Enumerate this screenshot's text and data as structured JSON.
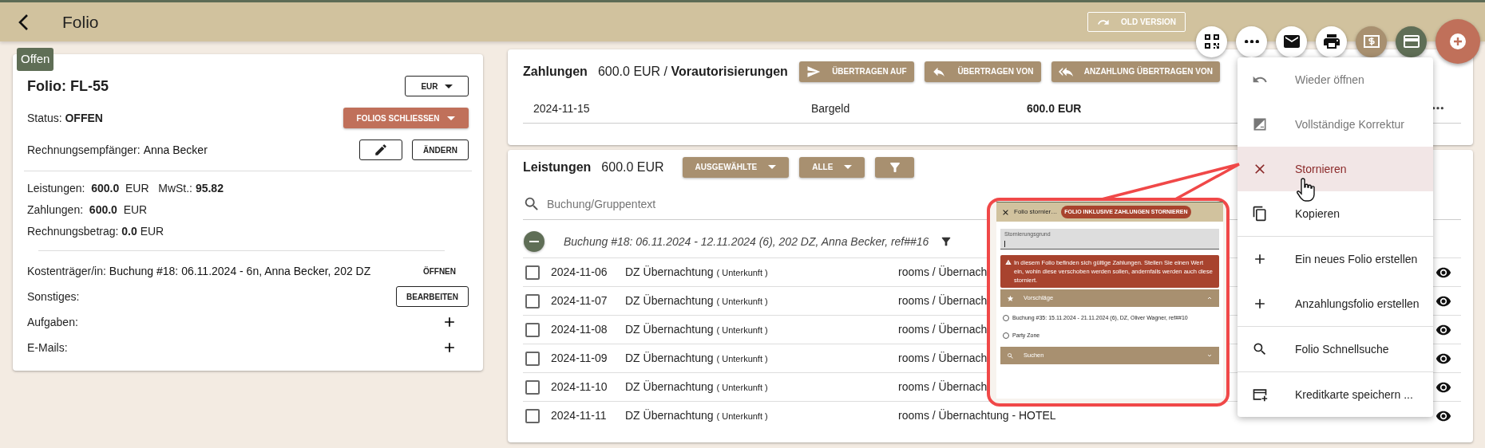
{
  "top_bar": {
    "title": "Folio",
    "old_version_button": "OLD VERSION"
  },
  "action_buttons": [
    {
      "kind": "qr"
    },
    {
      "kind": "more"
    },
    {
      "kind": "mail"
    },
    {
      "kind": "print"
    },
    {
      "kind": "bill"
    },
    {
      "kind": "card"
    },
    {
      "kind": "add"
    }
  ],
  "folio": {
    "badge": "Offen",
    "title": "Folio: FL-55",
    "currency": "EUR",
    "status": "Status: **OFFEN**",
    "close_button": "FOLIOS SCHLIESSEN",
    "recipient_label": "Rechnungsempfänger:",
    "recipient": "Anna Becker",
    "change_button": "ÄNDERN",
    "totals": [
      "Leistungen:  **600.0**  EUR   MwSt.: **95.82**",
      "Zahlungen:  **600.0**  EUR",
      "Rechnungsbetrag: **0.0** EUR"
    ],
    "payer_label": "Kostenträger/in:",
    "payer": "Buchung #18: 06.11.2024 - 6n, Anna Becker, 202 DZ",
    "open_button": "ÖFFNEN",
    "extras": [
      {
        "label": "Sonstiges:",
        "kind": "button",
        "button": "BEARBEITEN"
      },
      {
        "label": "Aufgaben:",
        "kind": "add"
      },
      {
        "label": "E-Mails:",
        "kind": "add"
      }
    ]
  },
  "payments": {
    "title": "Zahlungen",
    "summary": "600.0 EUR / **Vorautorisierungen**",
    "buttons": [
      {
        "label": "ÜBERTRAGEN AUF",
        "kind": "send"
      },
      {
        "label": "ÜBERTRAGEN VON",
        "kind": "reply"
      },
      {
        "label": "ANZAHLUNG ÜBERTRAGEN VON",
        "kind": "reply_all"
      }
    ],
    "rows": [
      {
        "date": "2024-11-15",
        "method": "Bargeld",
        "amount": "600.0 EUR"
      }
    ]
  },
  "services": {
    "title": "Leistungen",
    "total": "600.0 EUR",
    "buttons": [
      {
        "label": "AUSGEWÄHLTE",
        "kind": "dropdown"
      },
      {
        "label": "ALLE",
        "kind": "dropdown"
      },
      {
        "kind": "filter"
      }
    ],
    "search": {
      "placeholder": "Buchung/Gruppentext"
    },
    "group": {
      "label": "Buchung #18: 06.11.2024 - 12.11.2024 (6), 202 DZ, Anna Becker, ref##16",
      "expanded": true
    },
    "rows": [
      {
        "date": "2024-11-06",
        "name": "DZ Übernachtung",
        "category": "( Unterkunft )",
        "account": "rooms / Übernach",
        "checked": false
      },
      {
        "date": "2024-11-07",
        "name": "DZ Übernachtung",
        "category": "( Unterkunft )",
        "account": "rooms / Übernach",
        "checked": false
      },
      {
        "date": "2024-11-08",
        "name": "DZ Übernachtung",
        "category": "( Unterkunft )",
        "account": "rooms / Übernach",
        "checked": false
      },
      {
        "date": "2024-11-09",
        "name": "DZ Übernachtung",
        "category": "( Unterkunft )",
        "account": "rooms / Übernach",
        "checked": false
      },
      {
        "date": "2024-11-10",
        "name": "DZ Übernachtung",
        "category": "( Unterkunft )",
        "account": "rooms / Übernach",
        "checked": false
      },
      {
        "date": "2024-11-11",
        "name": "DZ Übernachtung",
        "category": "( Unterkunft )",
        "account": "rooms / Übernachtung - HOTEL",
        "checked": false
      }
    ]
  },
  "menu": {
    "sections": [
      [
        {
          "label": "Wieder öffnen",
          "kind": "undo",
          "disabled": true,
          "selected": false
        },
        {
          "label": "Vollständige Korrektur",
          "kind": "correction",
          "disabled": true,
          "selected": false
        },
        {
          "label": "Stornieren",
          "kind": "close",
          "disabled": false,
          "selected": true
        },
        {
          "label": "Kopieren",
          "kind": "copy",
          "disabled": false,
          "selected": false
        }
      ],
      [
        {
          "label": "Ein neues Folio erstellen",
          "kind": "add",
          "disabled": false,
          "selected": false
        },
        {
          "label": "Anzahlungsfolio erstellen",
          "kind": "add",
          "disabled": false,
          "selected": false
        }
      ],
      [
        {
          "label": "Folio Schnellsuche",
          "kind": "search",
          "disabled": false,
          "selected": false
        }
      ],
      [
        {
          "label": "Kreditkarte speichern ...",
          "kind": "card_add",
          "disabled": false,
          "selected": false
        }
      ]
    ]
  },
  "cancel_dialog_preview": {
    "title": "Folio stornier…",
    "confirm_button": "FOLIO INKLUSIVE ZAHLUNGEN STORNIEREN",
    "field": {
      "label": "Stornierungsgrund"
    },
    "alert": "In diesem Folio befinden sich gültige Zahlungen. Stellen Sie einen Wert ein, wohin diese verschoben werden sollen, andernfalls werden auch diese storniert.",
    "suggestions": {
      "title": "Vorschläge",
      "expanded": true,
      "options": [
        {
          "label": "Buchung #35: 15.11.2024 - 21.11.2024 (6), DZ, Oliver Wagner, ref##10",
          "selected": false
        },
        {
          "label": "Party Zone",
          "selected": false
        }
      ]
    },
    "search_section": {
      "title": "Suchen",
      "expanded": false
    }
  }
}
